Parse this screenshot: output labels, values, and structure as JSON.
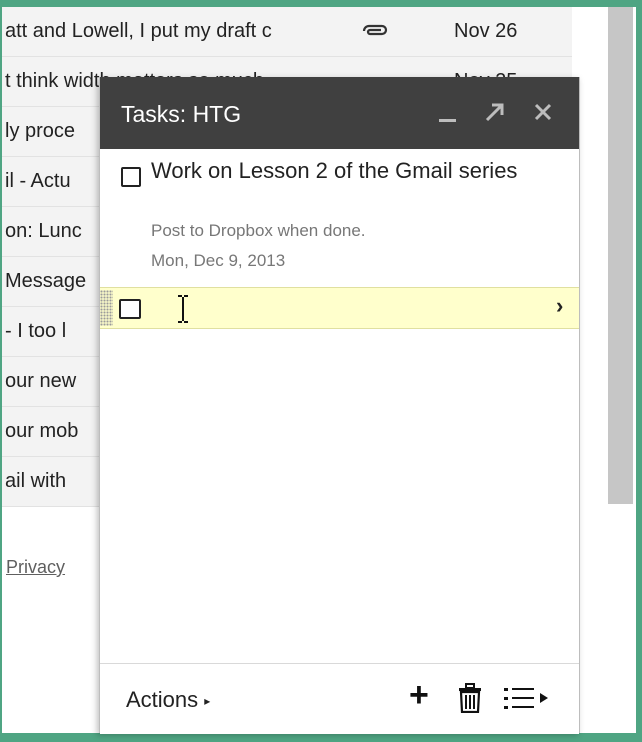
{
  "mail_rows": [
    {
      "snippet": "att and Lowell, I put my draft c",
      "date": "Nov 26",
      "has_attachment": true
    },
    {
      "snippet": "t think width matters so much",
      "date": "Nov 25"
    },
    {
      "snippet": "ly proce"
    },
    {
      "snippet": "il - Actu"
    },
    {
      "snippet": "on: Lunc"
    },
    {
      "snippet": "Message"
    },
    {
      "snippet": "- I too l"
    },
    {
      "snippet": "our new"
    },
    {
      "snippet": "our mob"
    },
    {
      "snippet": "ail with"
    }
  ],
  "footer_link": "Privacy",
  "tasks": {
    "title": "Tasks: HTG",
    "header_buttons": {
      "minimize": "_",
      "popout": "↗",
      "close": "✕"
    },
    "items": [
      {
        "title": "Work on Lesson 2 of the Gmail series",
        "notes": "Post to Dropbox when done.",
        "due": "Mon, Dec 9, 2013",
        "completed": false
      },
      {
        "title": "",
        "completed": false,
        "editing": true
      }
    ],
    "edit_chevron": "›",
    "footer": {
      "actions_label": "Actions",
      "actions_arrow": "▸",
      "add_label": "+"
    }
  },
  "colors": {
    "frame": "#4fa583",
    "header_bg": "#404040",
    "edit_row_bg": "#ffffcc",
    "mail_row_bg": "#f3f3f3"
  }
}
